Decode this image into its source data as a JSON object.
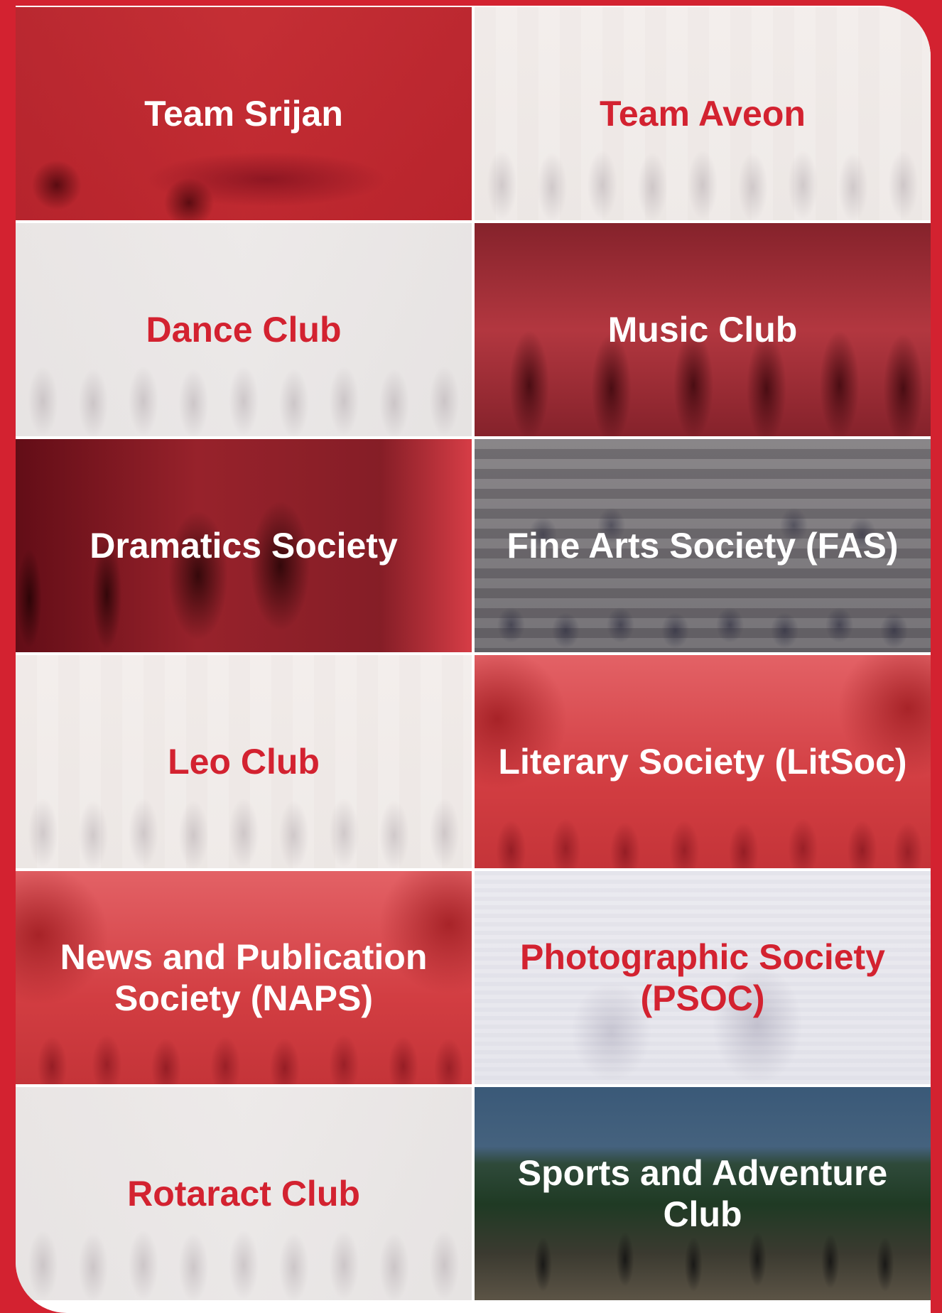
{
  "colors": {
    "brand_red": "#d32230",
    "white": "#ffffff"
  },
  "clubs": [
    {
      "label": "Team Srijan"
    },
    {
      "label": "Team Aveon"
    },
    {
      "label": "Dance Club"
    },
    {
      "label": "Music Club"
    },
    {
      "label": "Dramatics Society"
    },
    {
      "label": "Fine Arts Society (FAS)"
    },
    {
      "label": "Leo Club"
    },
    {
      "label": "Literary Society (LitSoc)"
    },
    {
      "label": "News and Publication Society (NAPS)"
    },
    {
      "label": "Photographic Society (PSOC)"
    },
    {
      "label": "Rotaract Club"
    },
    {
      "label": "Sports and Adventure Club"
    }
  ]
}
